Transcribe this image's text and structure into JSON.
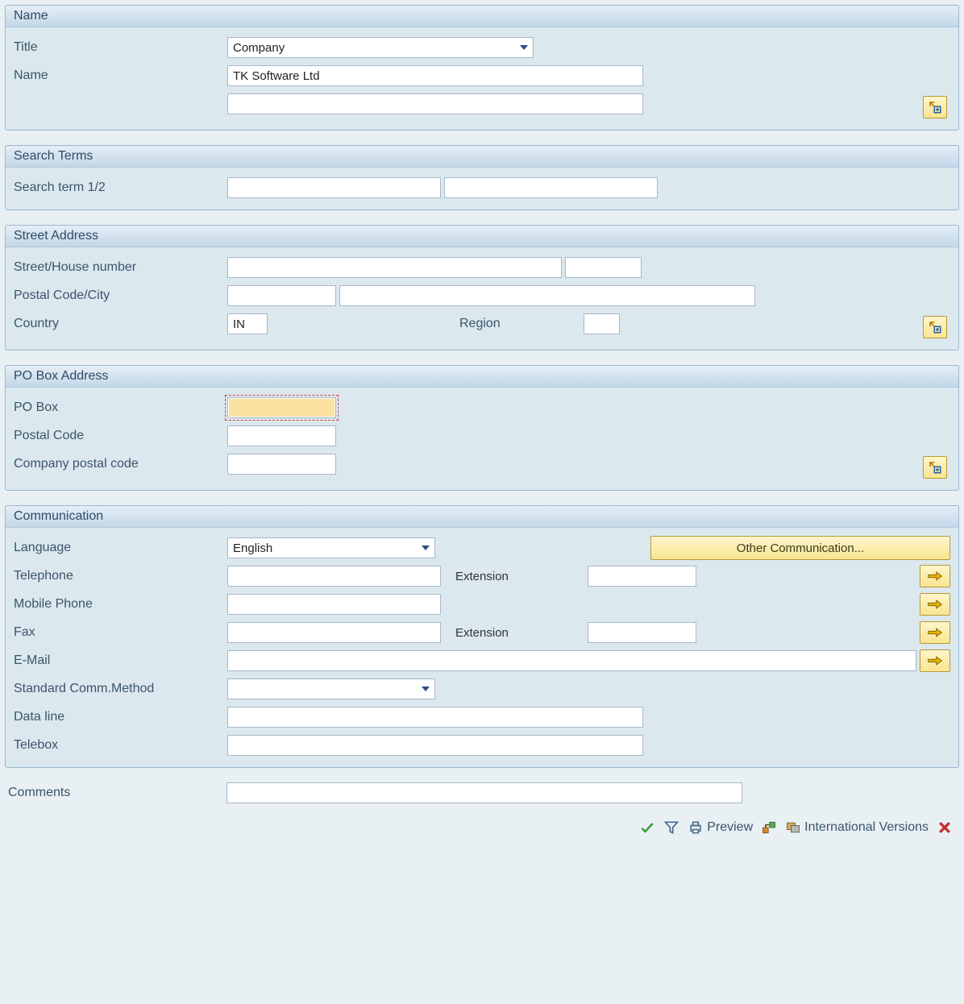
{
  "sections": {
    "name": {
      "header": "Name",
      "title_label": "Title",
      "title_value": "Company",
      "name_label": "Name",
      "name_value": "TK Software Ltd",
      "name_value2": ""
    },
    "search": {
      "header": "Search Terms",
      "term_label": "Search term 1/2",
      "term1_value": "",
      "term2_value": ""
    },
    "street": {
      "header": "Street Address",
      "street_label": "Street/House number",
      "street_value": "",
      "house_value": "",
      "postal_label": "Postal Code/City",
      "postal_value": "",
      "city_value": "",
      "country_label": "Country",
      "country_value": "IN",
      "region_label": "Region",
      "region_value": ""
    },
    "pobox": {
      "header": "PO Box Address",
      "pobox_label": "PO Box",
      "pobox_value": "",
      "postal_label": "Postal Code",
      "postal_value": "",
      "company_postal_label": "Company postal code",
      "company_postal_value": ""
    },
    "comm": {
      "header": "Communication",
      "language_label": "Language",
      "language_value": "English",
      "other_comm_label": "Other Communication...",
      "telephone_label": "Telephone",
      "telephone_value": "",
      "tel_ext_label": "Extension",
      "tel_ext_value": "",
      "mobile_label": "Mobile Phone",
      "mobile_value": "",
      "fax_label": "Fax",
      "fax_value": "",
      "fax_ext_label": "Extension",
      "fax_ext_value": "",
      "email_label": "E-Mail",
      "email_value": "",
      "std_comm_label": "Standard Comm.Method",
      "std_comm_value": "",
      "dataline_label": "Data line",
      "dataline_value": "",
      "telebox_label": "Telebox",
      "telebox_value": ""
    }
  },
  "comments_label": "Comments",
  "comments_value": "",
  "footer": {
    "preview": "Preview",
    "intl": "International Versions"
  }
}
